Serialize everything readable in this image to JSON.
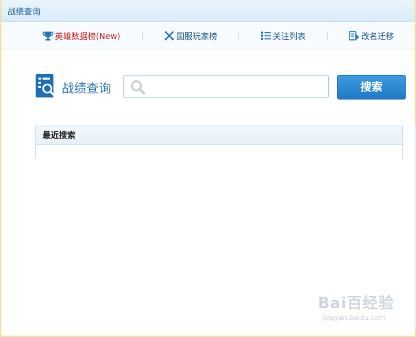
{
  "window": {
    "title": "战绩查询"
  },
  "nav": {
    "items": [
      {
        "label": "英雄数据榜(New)",
        "icon": "trophy-icon",
        "highlight": true
      },
      {
        "label": "国服玩家榜",
        "icon": "crossed-swords-icon",
        "highlight": false
      },
      {
        "label": "关注列表",
        "icon": "list-icon",
        "highlight": false
      },
      {
        "label": "改名迁移",
        "icon": "rename-migrate-icon",
        "highlight": false
      }
    ]
  },
  "search": {
    "heading": "战绩查询",
    "value": "",
    "placeholder": "",
    "button_label": "搜索"
  },
  "recent": {
    "header": "最近搜索",
    "items": []
  },
  "watermark": {
    "text": "Bai百经验",
    "sub": "jingyan.baidu.com"
  },
  "colors": {
    "accent": "#1f78c4",
    "highlight": "#d0262b",
    "nav_text": "#1d5b8e",
    "border_gold": "#f3dfa0"
  }
}
